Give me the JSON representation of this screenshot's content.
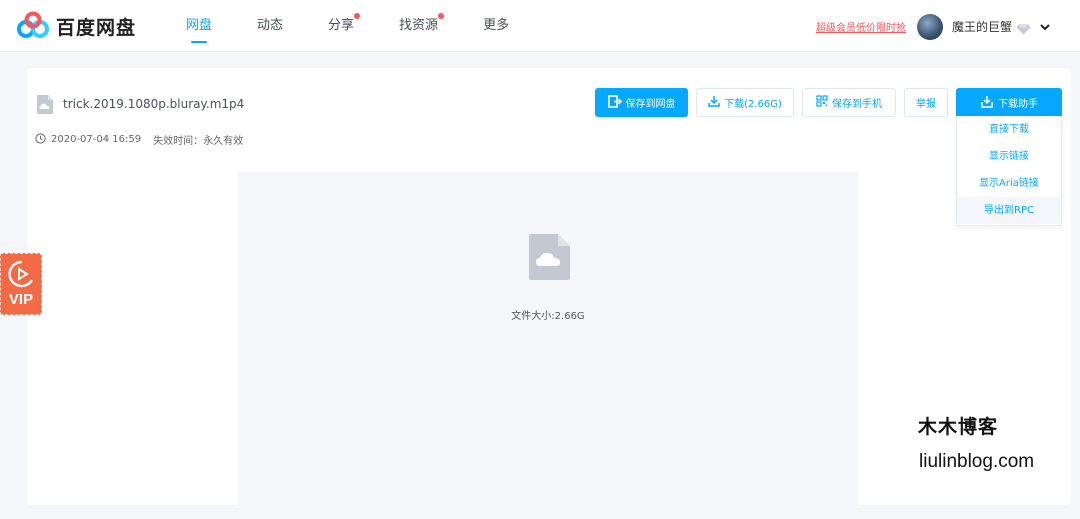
{
  "header": {
    "brand": "百度网盘",
    "nav": [
      {
        "label": "网盘",
        "active": true,
        "dot": false
      },
      {
        "label": "动态",
        "active": false,
        "dot": false
      },
      {
        "label": "分享",
        "active": false,
        "dot": true
      },
      {
        "label": "找资源",
        "active": false,
        "dot": true
      },
      {
        "label": "更多",
        "active": false,
        "dot": false
      }
    ],
    "promo": "超级会员低价限时抢",
    "username": "魔王的巨蟹"
  },
  "file": {
    "name": "trick.2019.1080p.bluray.m1p4",
    "date": "2020-07-04 16:59",
    "expire_label": "失效时间：永久有效",
    "size_label": "文件大小:2.66G"
  },
  "actions": {
    "save": "保存到网盘",
    "download": "下载(2.66G)",
    "save_phone": "保存到手机",
    "report": "举报",
    "helper": "下载助手"
  },
  "helper_menu": [
    "直接下载",
    "显示链接",
    "显示Aria链接",
    "导出到RPC"
  ],
  "vip_widget": {
    "label": "VIP"
  },
  "watermark": {
    "title": "木木博客",
    "url": "liulinblog.com"
  },
  "colors": {
    "accent": "#06a7ff",
    "alert": "#f5575c",
    "vip": "#f26a46"
  }
}
